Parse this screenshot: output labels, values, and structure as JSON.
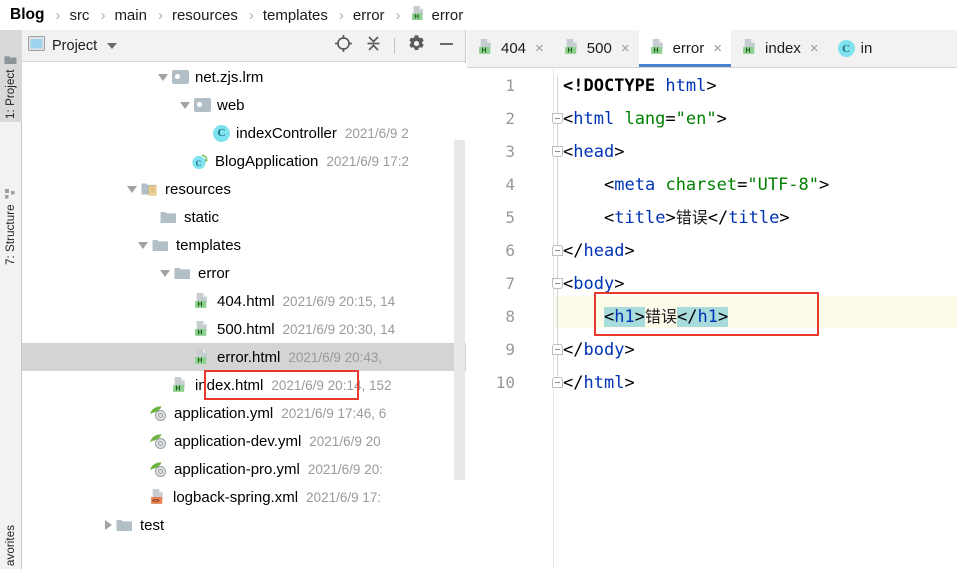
{
  "breadcrumb": {
    "items": [
      {
        "label": "Blog",
        "icon": null
      },
      {
        "label": "src",
        "icon": null
      },
      {
        "label": "main",
        "icon": null
      },
      {
        "label": "resources",
        "icon": null
      },
      {
        "label": "templates",
        "icon": null
      },
      {
        "label": "error",
        "icon": null
      },
      {
        "label": "error",
        "icon": "html-file-icon"
      }
    ],
    "separator": "›"
  },
  "left_toolbar": {
    "items": [
      {
        "label": "1: Project",
        "icon": "project-folder-icon",
        "active": true
      },
      {
        "label": "7: Structure",
        "icon": "structure-grid-icon",
        "active": false
      },
      {
        "label": "avorites",
        "icon": null,
        "active": false
      }
    ]
  },
  "project_panel": {
    "title": "Project",
    "caret": "chevron-down-icon",
    "actions": [
      {
        "name": "locate-icon",
        "label": "Select Opened File"
      },
      {
        "name": "collapse-all-icon",
        "label": "Collapse All"
      },
      {
        "name": "gear-icon",
        "label": "Settings"
      },
      {
        "name": "minimize-icon",
        "label": "Hide"
      }
    ]
  },
  "tree": {
    "rows": [
      {
        "label": "net.zjs.lrm",
        "timestamp": "",
        "icon": "package-icon",
        "indent": 3,
        "arrow": "down",
        "selected": false
      },
      {
        "label": "web",
        "timestamp": "",
        "icon": "package-icon",
        "indent": 4,
        "arrow": "down",
        "selected": false
      },
      {
        "label": "indexController",
        "timestamp": "2021/6/9 2",
        "icon": "class-icon",
        "indent": 5,
        "arrow": "none",
        "selected": false
      },
      {
        "label": "BlogApplication",
        "timestamp": "2021/6/9 17:2",
        "icon": "spring-class-icon",
        "indent": 4,
        "arrow": "none",
        "selected": false
      },
      {
        "label": "resources",
        "timestamp": "",
        "icon": "resources-folder-icon",
        "indent": 2,
        "arrow": "down",
        "selected": false
      },
      {
        "label": "static",
        "timestamp": "",
        "icon": "folder-icon",
        "indent": 3,
        "arrow": "none",
        "selected": false
      },
      {
        "label": "templates",
        "timestamp": "",
        "icon": "folder-icon",
        "indent": 3,
        "arrow": "down",
        "selected": false
      },
      {
        "label": "error",
        "timestamp": "",
        "icon": "folder-icon",
        "indent": 4,
        "arrow": "down",
        "selected": false
      },
      {
        "label": "404.html",
        "timestamp": "2021/6/9 20:15, 14",
        "icon": "html-file-icon",
        "indent": 5,
        "arrow": "none",
        "selected": false
      },
      {
        "label": "500.html",
        "timestamp": "2021/6/9 20:30, 14",
        "icon": "html-file-icon",
        "indent": 5,
        "arrow": "none",
        "selected": false
      },
      {
        "label": "error.html",
        "timestamp": "2021/6/9 20:43,",
        "icon": "html-file-icon",
        "indent": 5,
        "arrow": "none",
        "selected": true
      },
      {
        "label": "index.html",
        "timestamp": "2021/6/9 20:14, 152",
        "icon": "html-file-icon",
        "indent": 4,
        "arrow": "none",
        "selected": false
      },
      {
        "label": "application.yml",
        "timestamp": "2021/6/9 17:46, 6",
        "icon": "spring-yaml-icon",
        "indent": 3,
        "arrow": "none",
        "selected": false
      },
      {
        "label": "application-dev.yml",
        "timestamp": "2021/6/9 20",
        "icon": "spring-yaml-icon",
        "indent": 3,
        "arrow": "none",
        "selected": false
      },
      {
        "label": "application-pro.yml",
        "timestamp": "2021/6/9 20:",
        "icon": "spring-yaml-icon",
        "indent": 3,
        "arrow": "none",
        "selected": false
      },
      {
        "label": "logback-spring.xml",
        "timestamp": "2021/6/9 17:",
        "icon": "xml-file-icon",
        "indent": 3,
        "arrow": "none",
        "selected": false
      },
      {
        "label": "test",
        "timestamp": "",
        "icon": "folder-icon",
        "indent": 2,
        "arrow": "right",
        "selected": false
      }
    ]
  },
  "editor": {
    "tabs": [
      {
        "label": "404",
        "icon": "html-file-icon",
        "active": false,
        "close": "×"
      },
      {
        "label": "500",
        "icon": "html-file-icon",
        "active": false,
        "close": "×"
      },
      {
        "label": "error",
        "icon": "html-file-icon",
        "active": true,
        "close": "×"
      },
      {
        "label": "index",
        "icon": "html-file-icon",
        "active": false,
        "close": "×"
      },
      {
        "label": "in",
        "icon": "class-icon",
        "active": false,
        "close": ""
      }
    ],
    "active_tab": "error",
    "accent_color": "#4982cf",
    "caret_line": 8,
    "line_numbers": [
      1,
      2,
      3,
      4,
      5,
      6,
      7,
      8,
      9,
      10
    ],
    "code_lines": [
      {
        "n": 1,
        "text": "<!DOCTYPE html>"
      },
      {
        "n": 2,
        "text": "<html lang=\"en\">"
      },
      {
        "n": 3,
        "text": "<head>"
      },
      {
        "n": 4,
        "text": "    <meta charset=\"UTF-8\">"
      },
      {
        "n": 5,
        "text": "    <title>错误</title>"
      },
      {
        "n": 6,
        "text": "</head>"
      },
      {
        "n": 7,
        "text": "<body>"
      },
      {
        "n": 8,
        "text": "    <h1>错误</h1>"
      },
      {
        "n": 9,
        "text": "</body>"
      },
      {
        "n": 10,
        "text": "</html>"
      }
    ],
    "tokens": {
      "doctype": "<!DOCTYPE",
      "doctype_name": "html",
      "gt": ">",
      "lt": "<",
      "html_tag": "html",
      "lang_attr": "lang",
      "eq": "=",
      "lang_value": "\"en\"",
      "head_tag": "head",
      "meta_tag": "meta",
      "charset_attr": "charset",
      "charset_value": "\"UTF-8\"",
      "title_tag": "title",
      "title_text": "错误",
      "close_head": "</head>",
      "body_tag": "body",
      "h1_open": "<h1>",
      "h1_text": "错误",
      "h1_close": "</h1>",
      "close_body": "</body>",
      "close_html": "</html>"
    },
    "syntax_colors": {
      "tag": "#0033b3",
      "attribute": "#008000",
      "value": "#008000",
      "bracket": "#000000",
      "text": "#1c1c1c",
      "tag_highlight_bg": "#a8dcdc",
      "caret_line_bg": "#fcfae8"
    }
  },
  "annotations": {
    "color": "#e8392f",
    "boxes": [
      {
        "name": "error-html-tree-highlight",
        "target": "error.html"
      },
      {
        "name": "h1-code-highlight",
        "target": "<h1>错误</h1>"
      }
    ]
  }
}
